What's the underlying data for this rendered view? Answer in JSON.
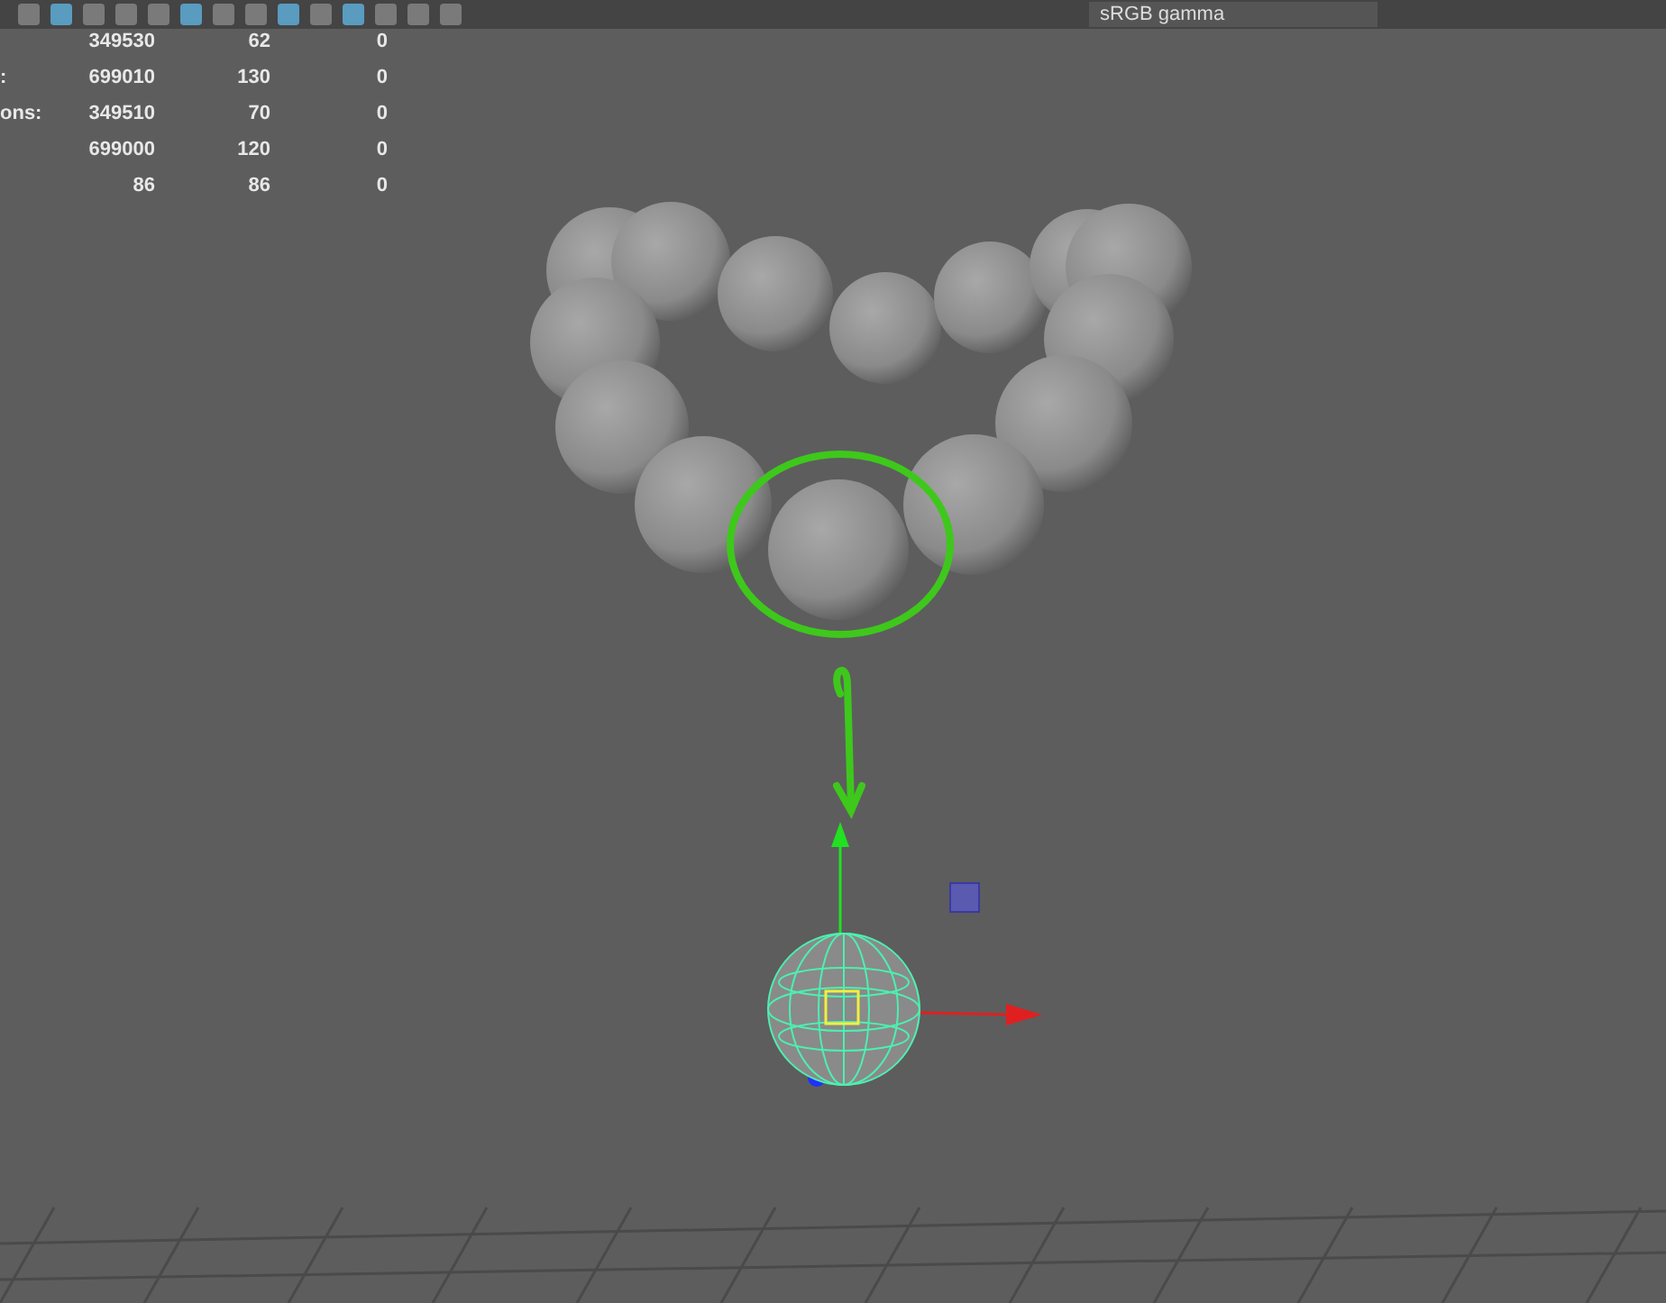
{
  "toolbar": {
    "color_space": "sRGB gamma"
  },
  "stats": {
    "rows": [
      {
        "column_1": "349530",
        "column_2": "62",
        "column_3": "0"
      },
      {
        "label": ":",
        "column_1": "699010",
        "column_2": "130",
        "column_3": "0"
      },
      {
        "label": "ons:",
        "column_1": "349510",
        "column_2": "70",
        "column_3": "0"
      },
      {
        "column_1": "699000",
        "column_2": "120",
        "column_3": "0"
      },
      {
        "column_1": "86",
        "column_2": "86",
        "column_3": "0"
      }
    ]
  }
}
